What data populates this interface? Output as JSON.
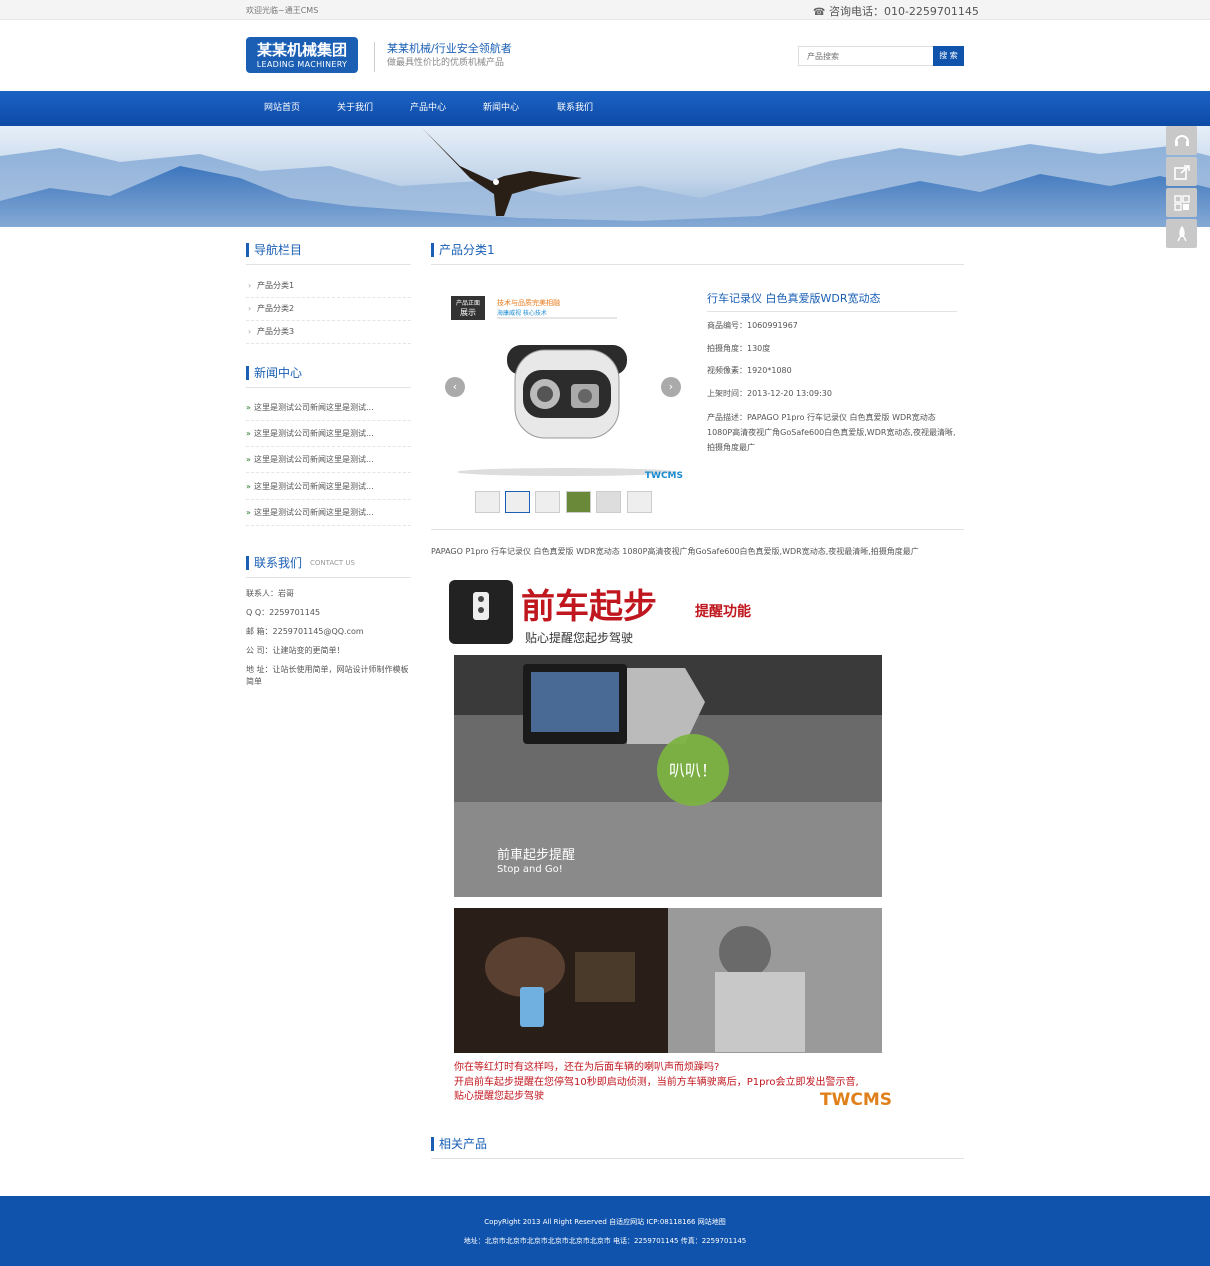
{
  "topbar": {
    "welcome": "欢迎光临~通王CMS",
    "hotline": "咨询电话：010-2259701145"
  },
  "logo": {
    "cn": "某某机械集团",
    "en": "LEADING MACHINERY"
  },
  "slogan": {
    "line1": "某某机械/行业安全领航者",
    "line2": "做最具性价比的优质机械产品"
  },
  "search": {
    "placeholder": "产品搜索",
    "button": "搜 索"
  },
  "nav": [
    "网站首页",
    "关于我们",
    "产品中心",
    "新闻中心",
    "联系我们"
  ],
  "sidebar": {
    "nav_title": "导航栏目",
    "categories": [
      "产品分类1",
      "产品分类2",
      "产品分类3"
    ],
    "news_title": "新闻中心",
    "news": [
      "这里是测试公司新闻这里是测试...",
      "这里是测试公司新闻这里是测试...",
      "这里是测试公司新闻这里是测试...",
      "这里是测试公司新闻这里是测试...",
      "这里是测试公司新闻这里是测试..."
    ],
    "contact_title": "联系我们",
    "contact_en": "CONTACT US",
    "contact": {
      "person": "联系人：岩哥",
      "qq": "Q Q：2259701145",
      "email": "邮 箱：2259701145@QQ.com",
      "company": "公 司：让建站变的更简单！",
      "address": "地 址：让站长使用简单，网站设计师制作模板简单"
    }
  },
  "main": {
    "title": "产品分类1",
    "product": {
      "name": "行车记录仪 白色真爱版WDR宽动态",
      "code": "商品编号：1060991967",
      "angle": "拍摄角度：130度",
      "pixels": "视频像素：1920*1080",
      "date": "上架时间：2013-12-20 13:09:30",
      "desc": "产品描述：PAPAGO P1pro 行车记录仪 白色真爱版 WDR宽动态 1080P高清夜视广角GoSafe600白色真爱版,WDR宽动态,夜视最清晰,拍摄角度最广"
    },
    "product_image": {
      "tag1": "产品正面",
      "tag2": "展示",
      "headline": "技术与品质完美相融",
      "sub": "海康威视 核心技术",
      "watermark": "TWCMS"
    },
    "summary": "PAPAGO P1pro 行车记录仪 白色真爱版 WDR宽动态 1080P高清夜视广角GoSafe600白色真爱版,WDR宽动态,夜视最清晰,拍摄角度最广",
    "feature": {
      "headline": "前车起步",
      "headline_small": "提醒功能",
      "subline": "贴心提醒您起步驾驶",
      "bubble": "叭叭！",
      "caption_cn": "前車起步提醒",
      "caption_en": "Stop and Go!",
      "text1": "你在等红灯时有这样吗，还在为后面车辆的喇叭声而烦躁吗?",
      "text2": "开启前车起步提醒在您停驾10秒即启动侦测，当前方车辆驶离后，P1pro会立即发出警示音,",
      "text3": "贴心提醒您起步驾驶",
      "watermark": "TWCMS"
    },
    "related_title": "相关产品"
  },
  "footer": {
    "line1": "CopyRight 2013 All Right Reserved 自适应网站 ICP:08118166 网站地图",
    "line2": "地址：北京市北京市北京市北京市北京市北京市  电话：2259701145  传真：2259701145"
  },
  "colors": {
    "brand": "#1a5fb4",
    "nav": "#0f53ad"
  }
}
